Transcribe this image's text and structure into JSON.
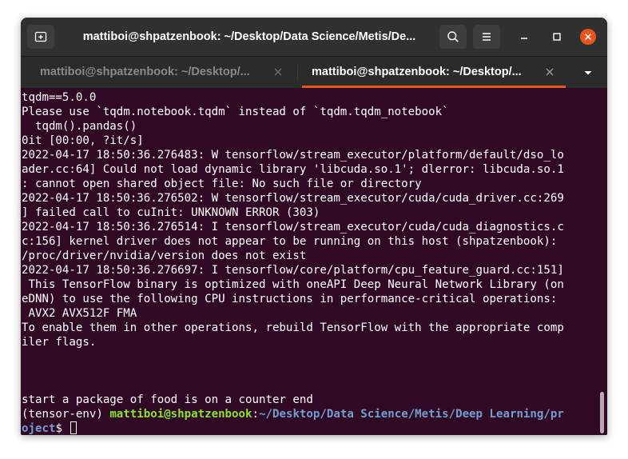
{
  "window": {
    "title": "mattiboi@shpatzenbook: ~/Desktop/Data Science/Metis/De..."
  },
  "tabs": [
    {
      "label": "mattiboi@shpatzenbook: ~/Desktop/...",
      "active": false
    },
    {
      "label": "mattiboi@shpatzenbook: ~/Desktop/...",
      "active": true
    }
  ],
  "colors": {
    "accent": "#e95420",
    "terminal_bg": "#300a24",
    "prompt_user": "#8ae234",
    "prompt_path": "#729fcf"
  },
  "icons": {
    "new_tab": "new-tab-icon",
    "search": "search-icon",
    "menu": "hamburger-menu-icon",
    "minimize": "minimize-icon",
    "maximize": "maximize-icon",
    "close": "close-icon",
    "tab_close": "tab-close-icon",
    "tabs_dropdown": "chevron-down-icon"
  },
  "terminal": {
    "lines": [
      "tqdm==5.0.0",
      "Please use `tqdm.notebook.tqdm` instead of `tqdm.tqdm_notebook`",
      "  tqdm().pandas()",
      "0it [00:00, ?it/s]",
      "2022-04-17 18:50:36.276483: W tensorflow/stream_executor/platform/default/dso_lo",
      "ader.cc:64] Could not load dynamic library 'libcuda.so.1'; dlerror: libcuda.so.1",
      ": cannot open shared object file: No such file or directory",
      "2022-04-17 18:50:36.276502: W tensorflow/stream_executor/cuda/cuda_driver.cc:269",
      "] failed call to cuInit: UNKNOWN ERROR (303)",
      "2022-04-17 18:50:36.276514: I tensorflow/stream_executor/cuda/cuda_diagnostics.c",
      "c:156] kernel driver does not appear to be running on this host (shpatzenbook):",
      "/proc/driver/nvidia/version does not exist",
      "2022-04-17 18:50:36.276697: I tensorflow/core/platform/cpu_feature_guard.cc:151]",
      " This TensorFlow binary is optimized with oneAPI Deep Neural Network Library (on",
      "eDNN) to use the following CPU instructions in performance-critical operations:",
      " AVX2 AVX512F FMA",
      "To enable them in other operations, rebuild TensorFlow with the appropriate comp",
      "iler flags.",
      "",
      "",
      "",
      "start a package of food is on a counter end"
    ],
    "prompt": {
      "env": "(tensor-env) ",
      "user_host": "mattiboi@shpatzenbook",
      "colon": ":",
      "path_line1": "~/Desktop/Data Science/Metis/Deep Learning/pr",
      "path_line2": "oject",
      "symbol": "$ "
    }
  }
}
